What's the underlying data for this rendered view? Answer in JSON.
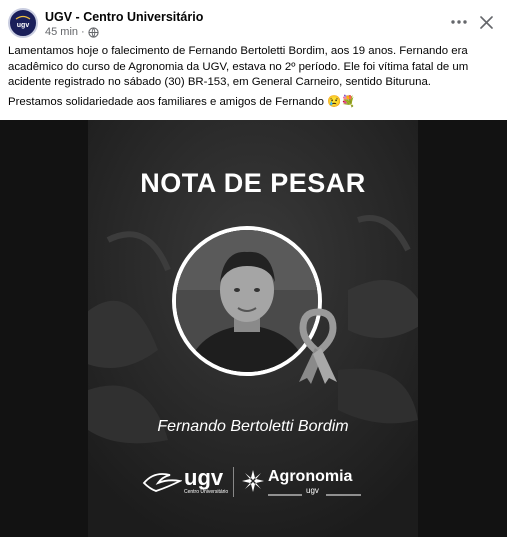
{
  "post": {
    "page_name": "UGV - Centro Universitário",
    "time": "45 min",
    "separator": "·",
    "paragraph1": "Lamentamos hoje o falecimento de Fernando Bertoletti Bordim, aos 19 anos. Fernando era acadêmico do curso de Agronomia da UGV, estava no 2º período. Ele foi vítima fatal de um acidente registrado no sábado (30) BR-153, em General Carneiro, sentido Bituruna.",
    "paragraph2": "Prestamos solidariedade aos familiares e amigos de Fernando 😢💐"
  },
  "header": {
    "more_icon": "more-horizontal-icon",
    "close_icon": "close-icon",
    "privacy_icon": "globe-icon"
  },
  "card": {
    "title": "NOTA DE PESAR",
    "person_name": "Fernando Bertoletti Bordim",
    "logo_ugv": "ugv",
    "logo_ugv_sub": "Centro Universitário",
    "logo_agro": "Agronomia",
    "logo_agro_sub": "ugv"
  },
  "colors": {
    "text": "#050505",
    "meta": "#65676b",
    "card_bg": "#2a2a2a",
    "frame_bg": "#121212"
  }
}
